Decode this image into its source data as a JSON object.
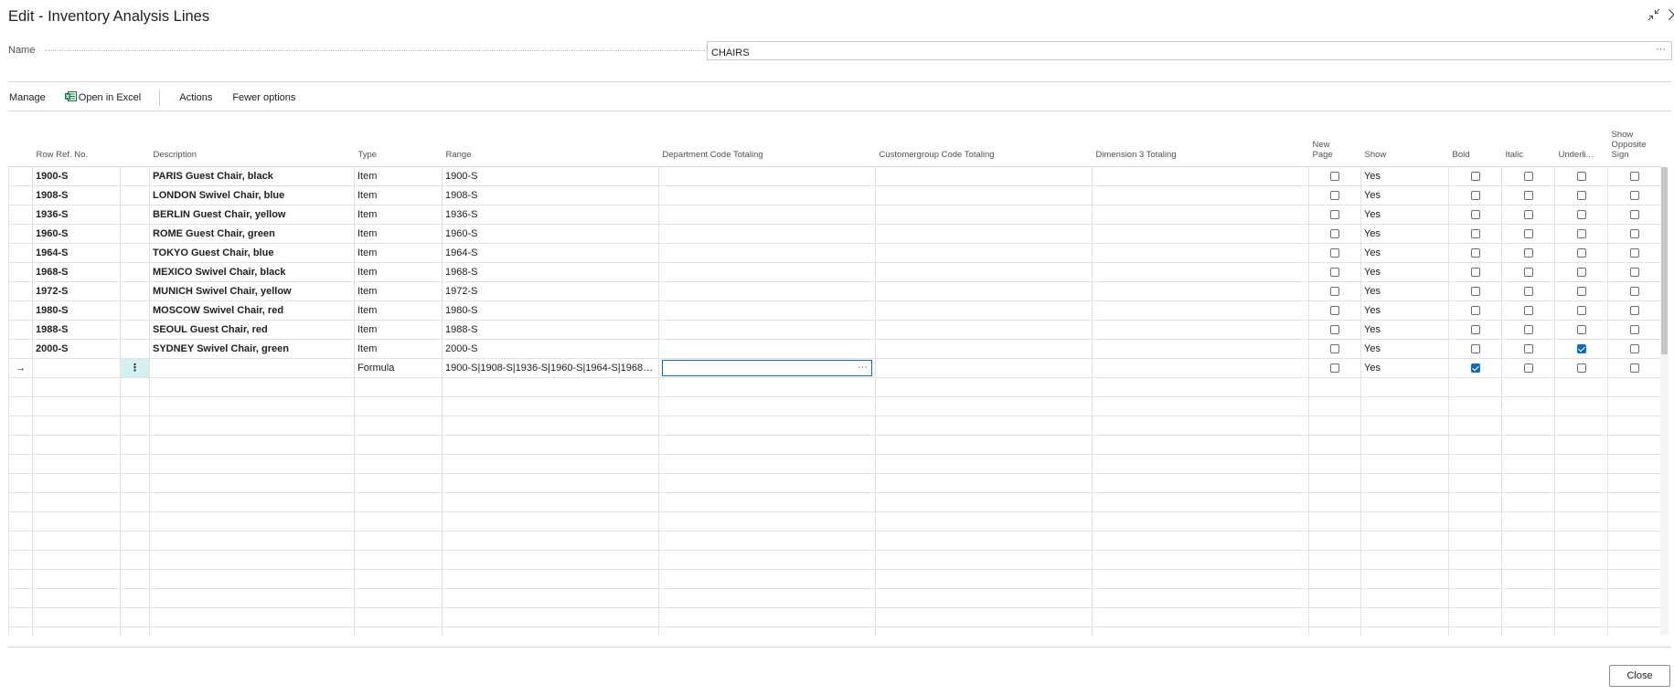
{
  "window": {
    "title": "Edit - Inventory Analysis Lines"
  },
  "name_field": {
    "label": "Name",
    "value": "CHAIRS",
    "ellipsis": "···"
  },
  "actionbar": {
    "manage": "Manage",
    "open_in_excel": "Open in Excel",
    "actions": "Actions",
    "fewer_options": "Fewer options"
  },
  "columns": {
    "row_ref_no": "Row Ref. No.",
    "description": "Description",
    "type": "Type",
    "range": "Range",
    "department_code_totaling": "Department Code Totaling",
    "customergroup_code_totaling": "Customergroup Code Totaling",
    "dimension_3_totaling": "Dimension 3 Totaling",
    "new_page_1": "New",
    "new_page_2": "Page",
    "show": "Show",
    "bold": "Bold",
    "italic": "Italic",
    "underline": "Underli...",
    "show_opposite_sign_1": "Show",
    "show_opposite_sign_2": "Opposite",
    "show_opposite_sign_3": "Sign"
  },
  "rows": [
    {
      "ref": "1900-S",
      "desc": "PARIS Guest Chair, black",
      "type": "Item",
      "range": "1900-S",
      "new_page": false,
      "show": "Yes",
      "bold": false,
      "italic": false,
      "underline": false,
      "opposite": false
    },
    {
      "ref": "1908-S",
      "desc": "LONDON Swivel Chair, blue",
      "type": "Item",
      "range": "1908-S",
      "new_page": false,
      "show": "Yes",
      "bold": false,
      "italic": false,
      "underline": false,
      "opposite": false
    },
    {
      "ref": "1936-S",
      "desc": "BERLIN Guest Chair, yellow",
      "type": "Item",
      "range": "1936-S",
      "new_page": false,
      "show": "Yes",
      "bold": false,
      "italic": false,
      "underline": false,
      "opposite": false
    },
    {
      "ref": "1960-S",
      "desc": "ROME Guest Chair, green",
      "type": "Item",
      "range": "1960-S",
      "new_page": false,
      "show": "Yes",
      "bold": false,
      "italic": false,
      "underline": false,
      "opposite": false
    },
    {
      "ref": "1964-S",
      "desc": "TOKYO Guest Chair, blue",
      "type": "Item",
      "range": "1964-S",
      "new_page": false,
      "show": "Yes",
      "bold": false,
      "italic": false,
      "underline": false,
      "opposite": false
    },
    {
      "ref": "1968-S",
      "desc": "MEXICO Swivel Chair, black",
      "type": "Item",
      "range": "1968-S",
      "new_page": false,
      "show": "Yes",
      "bold": false,
      "italic": false,
      "underline": false,
      "opposite": false
    },
    {
      "ref": "1972-S",
      "desc": "MUNICH Swivel Chair, yellow",
      "type": "Item",
      "range": "1972-S",
      "new_page": false,
      "show": "Yes",
      "bold": false,
      "italic": false,
      "underline": false,
      "opposite": false
    },
    {
      "ref": "1980-S",
      "desc": "MOSCOW Swivel Chair, red",
      "type": "Item",
      "range": "1980-S",
      "new_page": false,
      "show": "Yes",
      "bold": false,
      "italic": false,
      "underline": false,
      "opposite": false
    },
    {
      "ref": "1988-S",
      "desc": "SEOUL Guest Chair, red",
      "type": "Item",
      "range": "1988-S",
      "new_page": false,
      "show": "Yes",
      "bold": false,
      "italic": false,
      "underline": false,
      "opposite": false
    },
    {
      "ref": "2000-S",
      "desc": "SYDNEY Swivel Chair, green",
      "type": "Item",
      "range": "2000-S",
      "new_page": false,
      "show": "Yes",
      "bold": false,
      "italic": false,
      "underline": true,
      "opposite": false
    }
  ],
  "active_row": {
    "arrow": "→",
    "row_menu": "⋮",
    "type": "Formula",
    "range": "1900-S|1908-S|1936-S|1960-S|1964-S|1968-S|...",
    "ellipsis": "···",
    "new_page": false,
    "show": "Yes",
    "bold": true,
    "italic": false,
    "underline": false,
    "opposite": false
  },
  "empty_rows": 14,
  "footer": {
    "close": "Close"
  },
  "colors": {
    "accent": "#0f6cbd",
    "active_cell_bg": "#d4f0f0",
    "excel_green": "#107c41"
  },
  "icons": {
    "collapse": "collapse-icon",
    "close": "close-icon",
    "excel": "excel-icon",
    "row_arrow": "arrow-right-icon",
    "row_menu": "more-vertical-icon"
  }
}
